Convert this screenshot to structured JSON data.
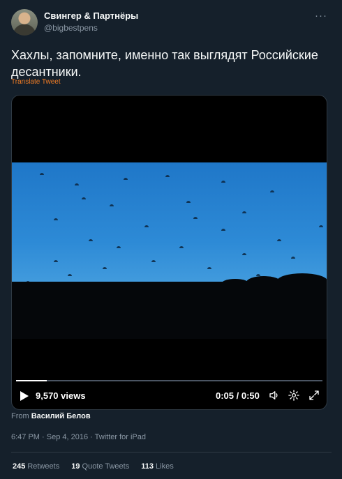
{
  "author": {
    "name": "Свингер & Партнёры",
    "handle": "@bigbestpens"
  },
  "tweet": {
    "text": "Хахлы, запомните, именно так выглядят Российские десантники.",
    "translate_label": "Translate Tweet"
  },
  "video": {
    "views": "9,570 views",
    "time": "0:05 / 0:50",
    "progress": 0.1,
    "icons": {
      "play": "play-icon",
      "volume": "volume-icon",
      "settings": "gear-icon",
      "fullscreen": "expand-icon",
      "more": "more-icon"
    }
  },
  "attribution": {
    "prefix": "From",
    "source": "Василий Белов"
  },
  "meta": "6:47 PM · Sep 4, 2016 · Twitter for iPad",
  "stats": {
    "retweets": {
      "count": "245",
      "label": "Retweets"
    },
    "quotes": {
      "count": "19",
      "label": "Quote Tweets"
    },
    "likes": {
      "count": "113",
      "label": "Likes"
    }
  },
  "colors": {
    "background": "#15202b",
    "accent_orange": "#f07c25",
    "muted": "#8b98a5"
  }
}
